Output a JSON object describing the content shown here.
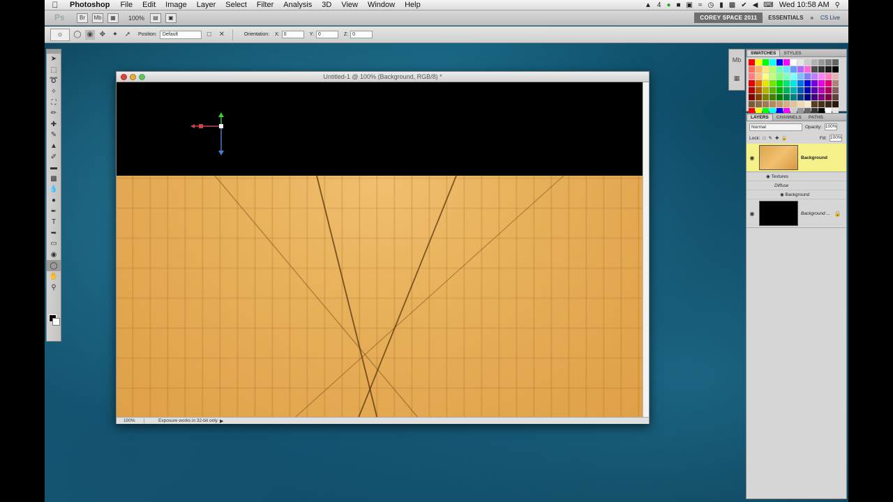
{
  "menubar": {
    "app_name": "Photoshop",
    "items": [
      "File",
      "Edit",
      "Image",
      "Layer",
      "Select",
      "Filter",
      "Analysis",
      "3D",
      "View",
      "Window",
      "Help"
    ],
    "status_badge": "4",
    "clock": "Wed 10:58 AM"
  },
  "appbar": {
    "logo": "Ps",
    "zoom": "100%",
    "workspace_active": "COREY SPACE 2011",
    "workspace": "ESSENTIALS",
    "cs_live": "CS Live"
  },
  "options": {
    "position_label": "Position:",
    "position_value": "Default",
    "orientation_label": "Orientation:",
    "x_label": "X:",
    "x_value": "0",
    "y_label": "Y:",
    "y_value": "0",
    "z_label": "Z:",
    "z_value": "0"
  },
  "document": {
    "title": "Untitled-1 @ 100% (Background, RGB/8) *",
    "zoom": "100%",
    "status_message": "Exposure works in 32-bit only"
  },
  "swatches_panel": {
    "tabs": [
      "SWATCHES",
      "STYLES"
    ],
    "colors": [
      "#ff0000",
      "#ffff00",
      "#00ff00",
      "#00ffff",
      "#0000ff",
      "#ff00ff",
      "#ffffff",
      "#e6e6e6",
      "#cccccc",
      "#b3b3b3",
      "#999999",
      "#808080",
      "#666666",
      "#ff6f61",
      "#ffb366",
      "#ffe680",
      "#b3ff66",
      "#66ffb3",
      "#66e6ff",
      "#6699ff",
      "#b366ff",
      "#ff66d9",
      "#4d4d4d",
      "#333333",
      "#1a1a1a",
      "#000000",
      "#ff8080",
      "#ffbf80",
      "#ffff80",
      "#bfff80",
      "#80ff80",
      "#80ffbf",
      "#80ffff",
      "#80bfff",
      "#8080ff",
      "#bf80ff",
      "#ff80ff",
      "#ff80bf",
      "#e6b3b3",
      "#e60000",
      "#e67300",
      "#e6e600",
      "#73e600",
      "#00e600",
      "#00e673",
      "#00e6e6",
      "#0073e6",
      "#0000e6",
      "#7300e6",
      "#e600e6",
      "#e60073",
      "#b38080",
      "#b30000",
      "#b35900",
      "#b3b300",
      "#59b300",
      "#00b300",
      "#00b359",
      "#00b3b3",
      "#0059b3",
      "#0000b3",
      "#5900b3",
      "#b300b3",
      "#b30059",
      "#806060",
      "#800000",
      "#804000",
      "#808000",
      "#408000",
      "#008000",
      "#008040",
      "#008080",
      "#004080",
      "#000080",
      "#400080",
      "#800080",
      "#800040",
      "#604040",
      "#7a5c3a",
      "#8c6a45",
      "#a07a50",
      "#b58a5c",
      "#c49a6c",
      "#d4ad80",
      "#e2c29a",
      "#efd6b4",
      "#f7e8d0",
      "#5a3f22",
      "#4a321a",
      "#3a2614",
      "#2a1a0c",
      "#ff0000",
      "#ffff00",
      "#00ff00",
      "#00ffff",
      "#0000ff",
      "#ff00ff",
      "#cccccc",
      "#999999",
      "#666666",
      "#333333",
      "#000000",
      "#ffffff",
      "#e6e6e6"
    ]
  },
  "layers_panel": {
    "tabs": [
      "LAYERS",
      "CHANNELS",
      "PATHS"
    ],
    "blend_mode": "Normal",
    "opacity_label": "Opacity:",
    "opacity_value": "100%",
    "lock_label": "Lock:",
    "fill_label": "Fill:",
    "fill_value": "100%",
    "layers": [
      {
        "name": "Background"
      },
      {
        "name": "Background ..."
      }
    ],
    "sublayers": [
      "Textures",
      "Diffuse",
      "Background"
    ]
  }
}
